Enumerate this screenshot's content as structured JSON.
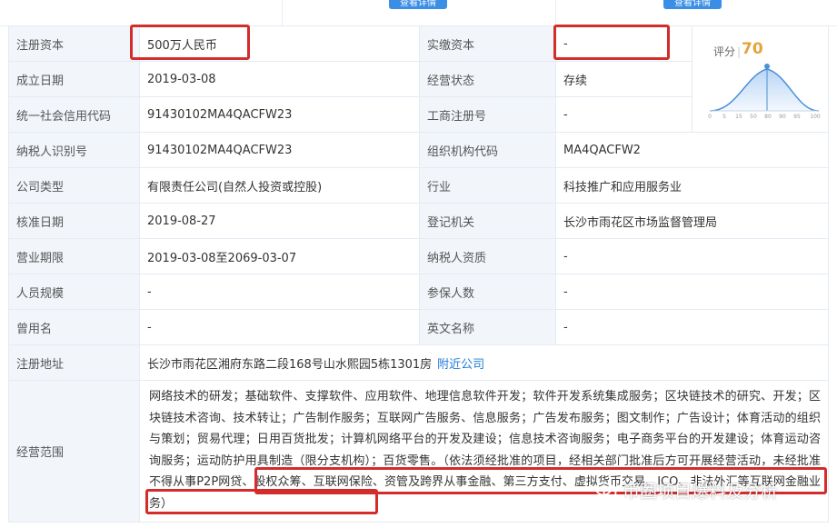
{
  "top": {
    "btn_left": "查看详情",
    "btn_right": "查看详情"
  },
  "rows": [
    {
      "l1": "注册资本",
      "v1": "500万人民币",
      "l2": "实缴资本",
      "v2": "-"
    },
    {
      "l1": "成立日期",
      "v1": "2019-03-08",
      "l2": "经营状态",
      "v2": "存续"
    },
    {
      "l1": "统一社会信用代码",
      "v1": "91430102MA4QACFW23",
      "l2": "工商注册号",
      "v2": "-"
    },
    {
      "l1": "纳税人识别号",
      "v1": "91430102MA4QACFW23",
      "l2": "组织机构代码",
      "v2": "MA4QACFW2"
    },
    {
      "l1": "公司类型",
      "v1": "有限责任公司(自然人投资或控股)",
      "l2": "行业",
      "v2": "科技推广和应用服务业"
    },
    {
      "l1": "核准日期",
      "v1": "2019-08-27",
      "l2": "登记机关",
      "v2": "长沙市雨花区市场监督管理局"
    },
    {
      "l1": "营业期限",
      "v1": "2019-03-08至2069-03-07",
      "l2": "纳税人资质",
      "v2": "-"
    },
    {
      "l1": "人员规模",
      "v1": "-",
      "l2": "参保人数",
      "v2": "-"
    },
    {
      "l1": "曾用名",
      "v1": "-",
      "l2": "英文名称",
      "v2": "-"
    }
  ],
  "address": {
    "label": "注册地址",
    "value": "长沙市雨花区湘府东路二段168号山水熙园5栋1301房",
    "link": "附近公司"
  },
  "scope": {
    "label": "经营范围",
    "text": "网络技术的研发；基础软件、支撑软件、应用软件、地理信息软件开发；软件开发系统集成服务；区块链技术的研究、开发；区块链技术咨询、技术转让；广告制作服务；互联网广告服务、信息服务；广告发布服务；图文制作；广告设计；体育活动的组织与策划；贸易代理；日用百货批发；计算机网络平台的开发及建设；信息技术咨询服务；电子商务平台的开发建设；体育运动咨询服务；运动防护用具制造（限分支机构）；百货零售。（依法须经批准的项目，经相关部门批准后方可开展经营活动，未经批准不得从事P2P网贷、股权众筹、互联网保险、资管及跨界从事金融、第三方支付、虚拟货币交易、ICO、非法外汇等互联网金融业务）"
  },
  "score": {
    "label": "评分",
    "value": "70",
    "axis": [
      "0",
      "5",
      "15",
      "50",
      "80",
      "90",
      "95",
      "100"
    ],
    "accent": "#e6a23c",
    "curve": "#4a90d9"
  },
  "watermark": {
    "text": "币圈项目爆料及分析"
  },
  "colors": {
    "highlight": "#d42b2b",
    "link": "#1e7ad6",
    "label_bg": "#f2f6fb"
  }
}
